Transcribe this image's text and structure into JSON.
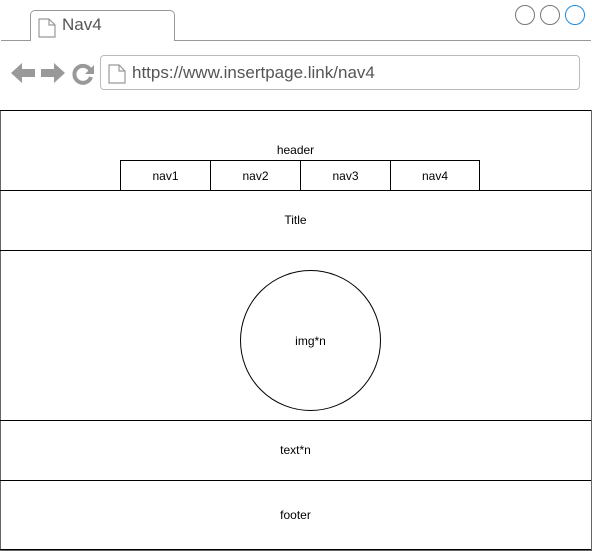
{
  "browser": {
    "tab_title": "Nav4",
    "url": "https://www.insertpage.link/nav4",
    "accent_color": "#1e8be0"
  },
  "icons": {
    "tab_doc": "document-icon",
    "address_doc": "document-icon",
    "back": "arrow-left-icon",
    "forward": "arrow-right-icon",
    "reload": "reload-icon"
  },
  "page": {
    "header": "header",
    "nav_items": [
      "nav1",
      "nav2",
      "nav3",
      "nav4"
    ],
    "title": "Title",
    "image": "img*n",
    "text": "text*n",
    "footer": "footer"
  }
}
